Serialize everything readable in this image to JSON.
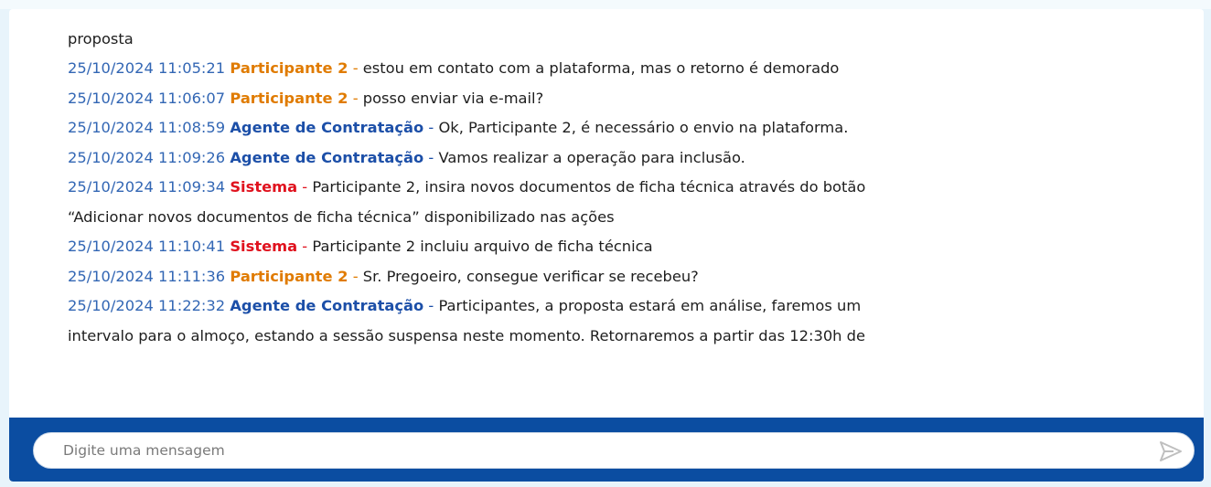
{
  "messages": [
    {
      "type": "fragment",
      "text": "proposta"
    },
    {
      "type": "msg",
      "ts": "25/10/2024 11:05:21",
      "author": "Participante 2",
      "role": "participant",
      "text": "estou em contato com a plataforma, mas o retorno é demorado"
    },
    {
      "type": "msg",
      "ts": "25/10/2024 11:06:07",
      "author": "Participante 2",
      "role": "participant",
      "text": "posso enviar via e-mail?"
    },
    {
      "type": "msg",
      "ts": "25/10/2024 11:08:59",
      "author": "Agente de Contratação",
      "role": "agent",
      "text": "Ok, Participante 2, é necessário o envio na plataforma."
    },
    {
      "type": "msg",
      "ts": "25/10/2024 11:09:26",
      "author": "Agente de Contratação",
      "role": "agent",
      "text": "Vamos realizar a operação para inclusão."
    },
    {
      "type": "msg",
      "ts": "25/10/2024 11:09:34",
      "author": "Sistema",
      "role": "system",
      "text": "Participante 2, insira novos documentos de ficha técnica através do botão"
    },
    {
      "type": "fragment",
      "text": "“Adicionar novos documentos de ficha técnica” disponibilizado nas ações"
    },
    {
      "type": "msg",
      "ts": "25/10/2024 11:10:41",
      "author": "Sistema",
      "role": "system",
      "text": "Participante 2 incluiu arquivo de ficha técnica"
    },
    {
      "type": "msg",
      "ts": "25/10/2024 11:11:36",
      "author": "Participante 2",
      "role": "participant",
      "text": "Sr. Pregoeiro, consegue verificar se recebeu?"
    },
    {
      "type": "msg",
      "ts": "25/10/2024 11:22:32",
      "author": "Agente de Contratação",
      "role": "agent",
      "text": "Participantes, a proposta estará em análise, faremos um"
    },
    {
      "type": "fragment",
      "text": "intervalo para o almoço, estando a sessão suspensa neste momento. Retornaremos a partir das 12:30h de"
    }
  ],
  "separator": "-",
  "composer": {
    "placeholder": "Digite uma mensagem",
    "send_icon": "send-icon"
  },
  "colors": {
    "timestamp": "#3266b4",
    "participant": "#e07b00",
    "agent": "#1c4fa8",
    "system": "#e0121e",
    "composer_bar": "#0b4da1"
  }
}
